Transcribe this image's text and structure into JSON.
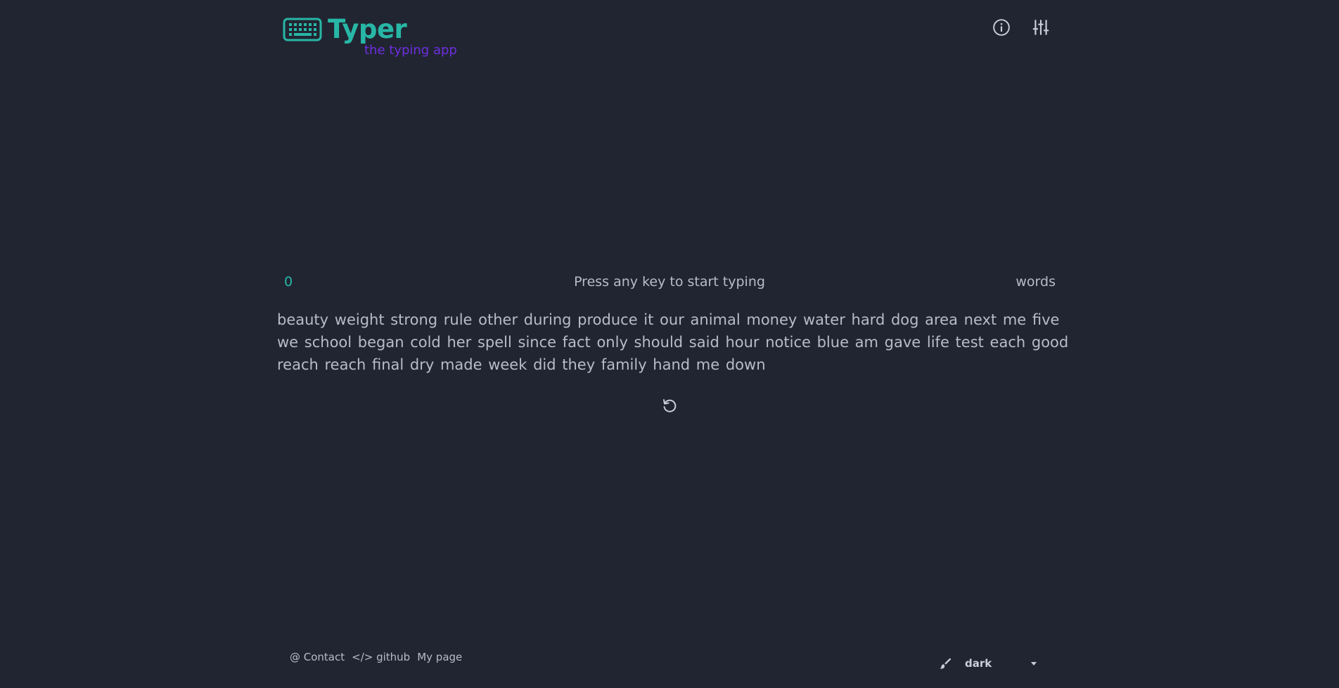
{
  "header": {
    "title": "Typer",
    "subtitle": "the typing app",
    "icons": [
      "keyboard-icon",
      "info-icon",
      "settings-sliders-icon"
    ]
  },
  "stats": {
    "counter": "0",
    "prompt": "Press any key to start typing",
    "mode": "words"
  },
  "words": {
    "lines": [
      "beauty weight strong rule other during produce it our animal money water hard dog area next me five",
      "we school began cold her spell since fact only should said hour notice blue am gave life test each good",
      "reach reach final dry made week did they family hand me down"
    ]
  },
  "restart": {
    "icon": "restart-icon"
  },
  "footer": {
    "contact": "@ Contact",
    "github": "</> github",
    "mypage": "My page",
    "theme_value": "dark",
    "theme_icon": "brush-icon"
  },
  "colors": {
    "background": "#212532",
    "accent": "#28b7a6",
    "subtitle": "#6e2ee0",
    "text": "#b7bcc9"
  }
}
